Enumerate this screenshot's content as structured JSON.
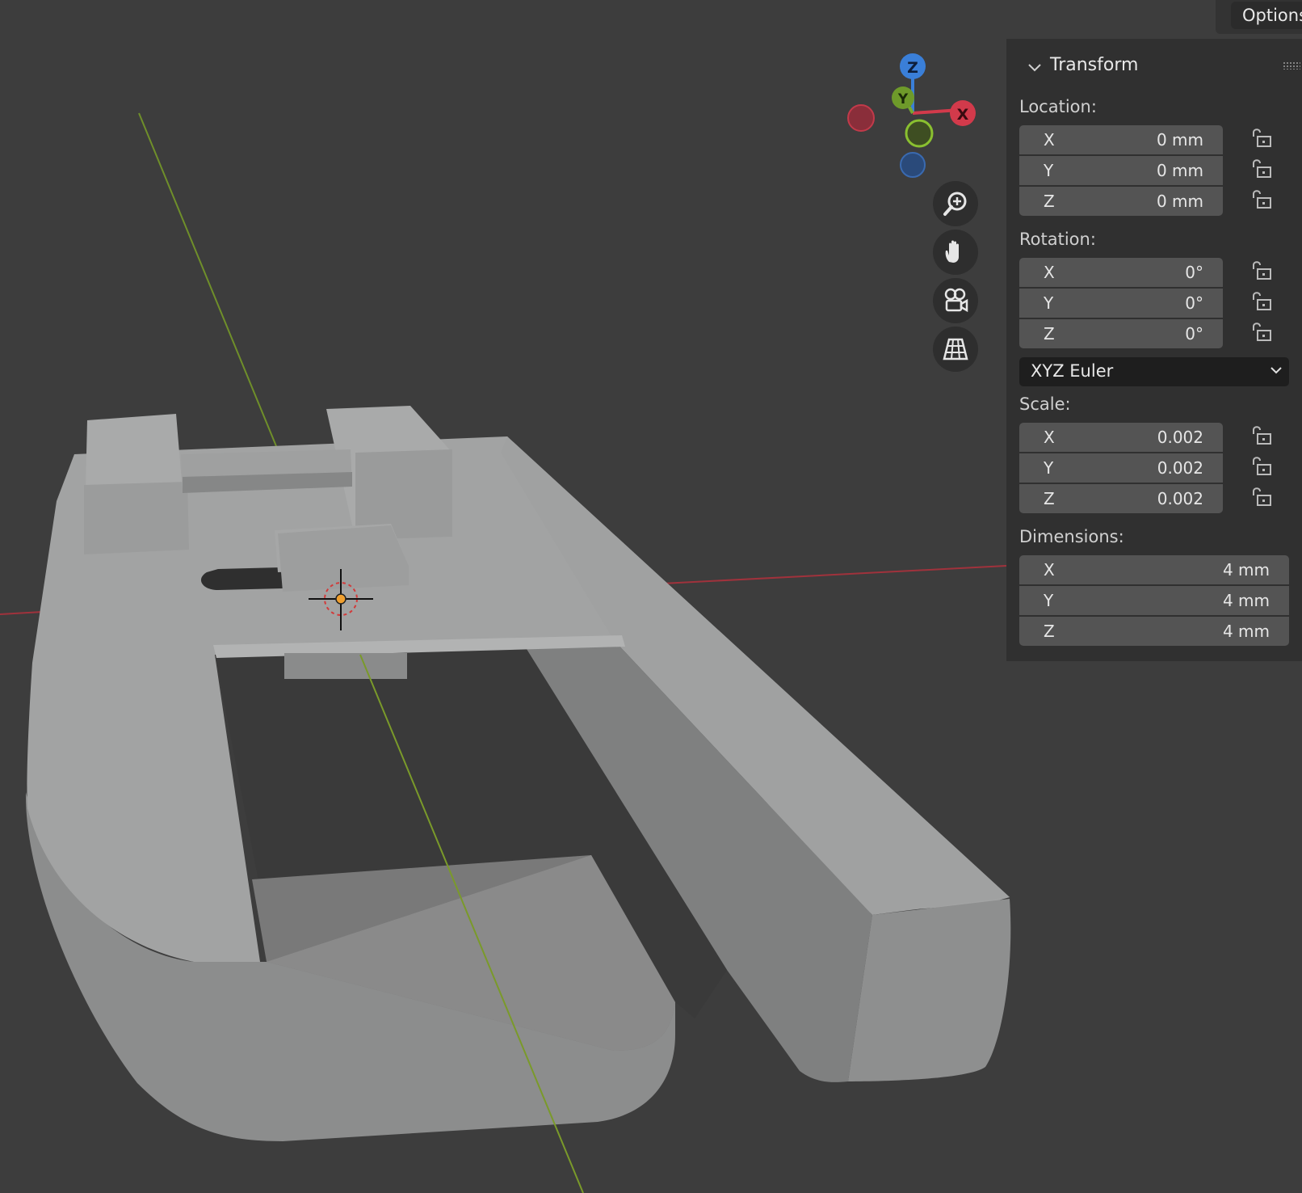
{
  "header": {
    "options_label": "Options"
  },
  "gizmo": {
    "z_label": "Z",
    "y_label": "Y",
    "x_label": "X"
  },
  "nav_tools": [
    "zoom-icon",
    "hand-pan-icon",
    "camera-icon",
    "grid-ortho-icon"
  ],
  "panel": {
    "title": "Transform",
    "location": {
      "label": "Location:",
      "rows": [
        {
          "axis": "X",
          "value": "0 mm"
        },
        {
          "axis": "Y",
          "value": "0 mm"
        },
        {
          "axis": "Z",
          "value": "0 mm"
        }
      ]
    },
    "rotation": {
      "label": "Rotation:",
      "rows": [
        {
          "axis": "X",
          "value": "0°"
        },
        {
          "axis": "Y",
          "value": "0°"
        },
        {
          "axis": "Z",
          "value": "0°"
        }
      ],
      "mode": "XYZ Euler"
    },
    "scale": {
      "label": "Scale:",
      "rows": [
        {
          "axis": "X",
          "value": "0.002"
        },
        {
          "axis": "Y",
          "value": "0.002"
        },
        {
          "axis": "Z",
          "value": "0.002"
        }
      ]
    },
    "dimensions": {
      "label": "Dimensions:",
      "rows": [
        {
          "axis": "X",
          "value": "4 mm"
        },
        {
          "axis": "Y",
          "value": "4 mm"
        },
        {
          "axis": "Z",
          "value": "4 mm"
        }
      ]
    }
  },
  "colors": {
    "background": "#3d3d3d",
    "axis_x": "#d23a4b",
    "axis_y": "#78a830",
    "axis_z": "#3a7fd8",
    "origin": "#f0a030"
  }
}
